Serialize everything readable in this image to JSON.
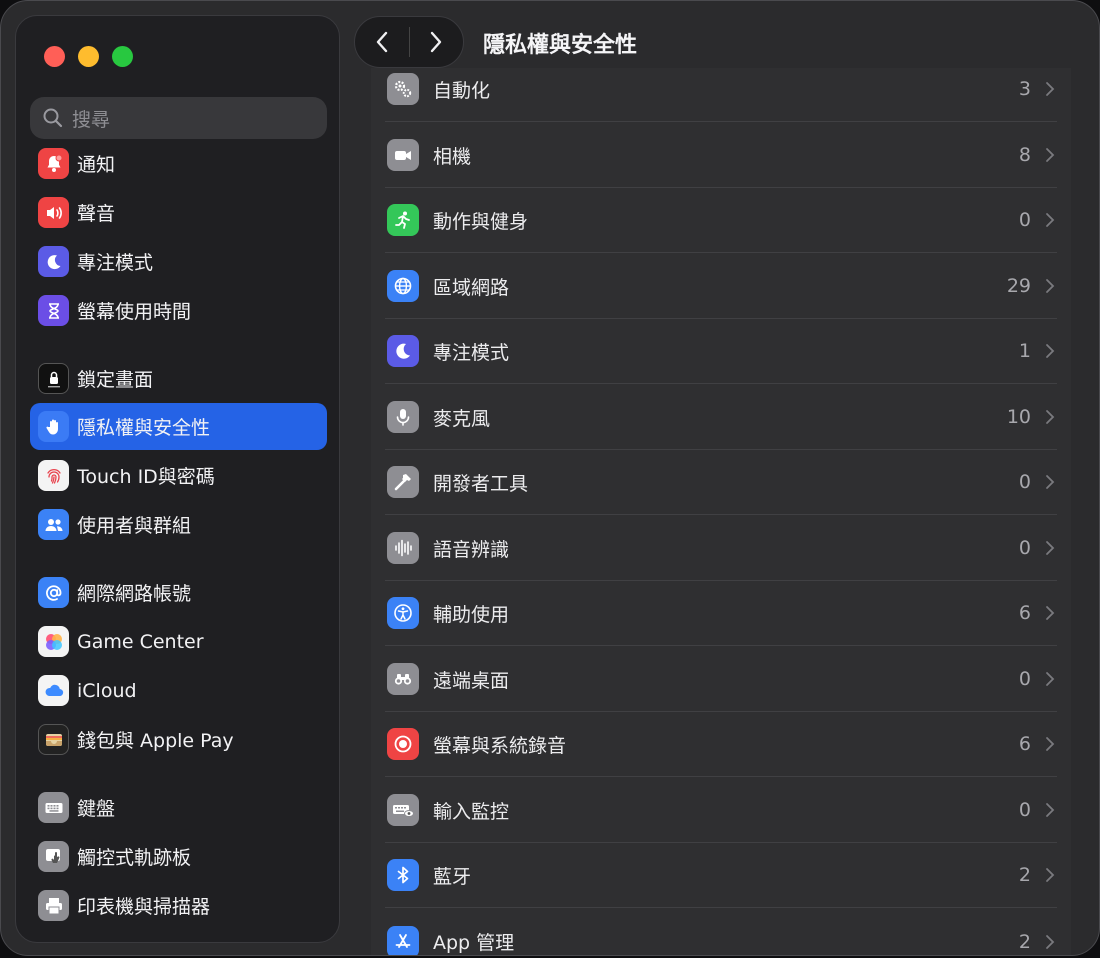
{
  "window": {
    "title": "隱私權與安全性"
  },
  "search": {
    "placeholder": "搜尋"
  },
  "sidebar": {
    "items": [
      {
        "label": "通知",
        "icon": "bell-icon",
        "color": "#ef4444"
      },
      {
        "label": "聲音",
        "icon": "speaker-icon",
        "color": "#ef4444"
      },
      {
        "label": "專注模式",
        "icon": "moon-icon",
        "color": "#5b5be6"
      },
      {
        "label": "螢幕使用時間",
        "icon": "hourglass-icon",
        "color": "#6b4ee6"
      },
      {
        "label": "鎖定畫面",
        "icon": "lock-screen-icon",
        "color": "#111111"
      },
      {
        "label": "隱私權與安全性",
        "icon": "hand-icon",
        "color": "#2f6bf0"
      },
      {
        "label": "Touch ID與密碼",
        "icon": "fingerprint-icon",
        "color": "#f4f4f4"
      },
      {
        "label": "使用者與群組",
        "icon": "users-icon",
        "color": "#3b82f6"
      },
      {
        "label": "網際網路帳號",
        "icon": "at-icon",
        "color": "#3b82f6"
      },
      {
        "label": "Game Center",
        "icon": "game-center-icon",
        "color": "#f4f4f4"
      },
      {
        "label": "iCloud",
        "icon": "cloud-icon",
        "color": "#f4f4f4"
      },
      {
        "label": "錢包與 Apple Pay",
        "icon": "wallet-icon",
        "color": "#222222"
      },
      {
        "label": "鍵盤",
        "icon": "keyboard-icon",
        "color": "#8e8e93"
      },
      {
        "label": "觸控式軌跡板",
        "icon": "trackpad-icon",
        "color": "#8e8e93"
      },
      {
        "label": "印表機與掃描器",
        "icon": "printer-icon",
        "color": "#8e8e93"
      }
    ]
  },
  "privacy": {
    "rows": [
      {
        "label": "自動化",
        "count": "3",
        "icon": "gears-icon",
        "color": "#8e8e93"
      },
      {
        "label": "相機",
        "count": "8",
        "icon": "camera-icon",
        "color": "#8e8e93"
      },
      {
        "label": "動作與健身",
        "count": "0",
        "icon": "running-icon",
        "color": "#34c759"
      },
      {
        "label": "區域網路",
        "count": "29",
        "icon": "globe-icon",
        "color": "#3b82f6"
      },
      {
        "label": "專注模式",
        "count": "1",
        "icon": "moon-icon",
        "color": "#5b5be6"
      },
      {
        "label": "麥克風",
        "count": "10",
        "icon": "microphone-icon",
        "color": "#8e8e93"
      },
      {
        "label": "開發者工具",
        "count": "0",
        "icon": "hammer-icon",
        "color": "#8e8e93"
      },
      {
        "label": "語音辨識",
        "count": "0",
        "icon": "waveform-icon",
        "color": "#8e8e93"
      },
      {
        "label": "輔助使用",
        "count": "6",
        "icon": "accessibility-icon",
        "color": "#3b82f6"
      },
      {
        "label": "遠端桌面",
        "count": "0",
        "icon": "binoculars-icon",
        "color": "#8e8e93"
      },
      {
        "label": "螢幕與系統錄音",
        "count": "6",
        "icon": "record-icon",
        "color": "#ef4444"
      },
      {
        "label": "輸入監控",
        "count": "0",
        "icon": "keyboard-eye-icon",
        "color": "#8e8e93"
      },
      {
        "label": "藍牙",
        "count": "2",
        "icon": "bluetooth-icon",
        "color": "#3b82f6"
      },
      {
        "label": "App 管理",
        "count": "2",
        "icon": "app-store-icon",
        "color": "#3b82f6"
      }
    ]
  }
}
